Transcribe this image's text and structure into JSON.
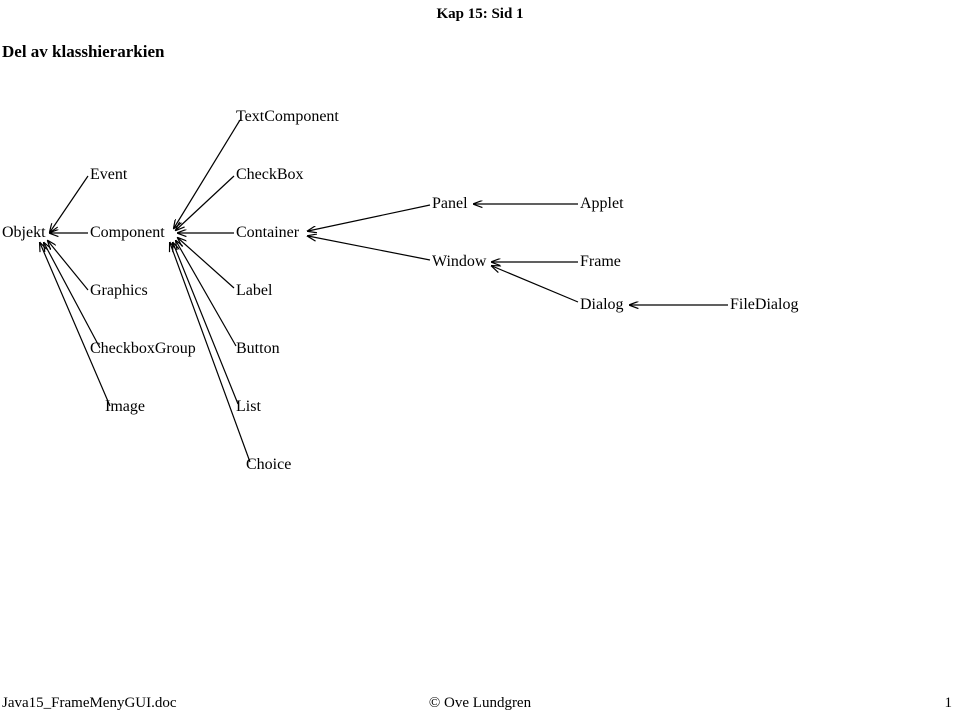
{
  "header": "Kap 15:  Sid 1",
  "heading": "Del av klasshierarkien",
  "nodes": {
    "objekt": "Objekt",
    "event": "Event",
    "component": "Component",
    "graphics": "Graphics",
    "checkboxgroup": "CheckboxGroup",
    "image": "Image",
    "textcomponent": "TextComponent",
    "checkbox": "CheckBox",
    "container": "Container",
    "label": "Label",
    "button": "Button",
    "list": "List",
    "choice": "Choice",
    "panel": "Panel",
    "window": "Window",
    "applet": "Applet",
    "frame": "Frame",
    "dialog": "Dialog",
    "filedialog": "FileDialog"
  },
  "footer": {
    "left": "Java15_FrameMenyGUI.doc",
    "center": "© Ove Lundgren",
    "right": "1"
  },
  "edges_comment": "each edge is child(arrow head) -> parent(tail)",
  "edges": [
    [
      "event",
      "objekt"
    ],
    [
      "component",
      "objekt"
    ],
    [
      "graphics",
      "objekt"
    ],
    [
      "checkboxgroup",
      "objekt"
    ],
    [
      "image",
      "objekt"
    ],
    [
      "textcomponent",
      "component"
    ],
    [
      "checkbox",
      "component"
    ],
    [
      "container",
      "component"
    ],
    [
      "label",
      "component"
    ],
    [
      "button",
      "component"
    ],
    [
      "list",
      "component"
    ],
    [
      "choice",
      "component"
    ],
    [
      "panel",
      "container"
    ],
    [
      "window",
      "container"
    ],
    [
      "applet",
      "panel"
    ],
    [
      "frame",
      "window"
    ],
    [
      "dialog",
      "window"
    ],
    [
      "filedialog",
      "dialog"
    ]
  ]
}
